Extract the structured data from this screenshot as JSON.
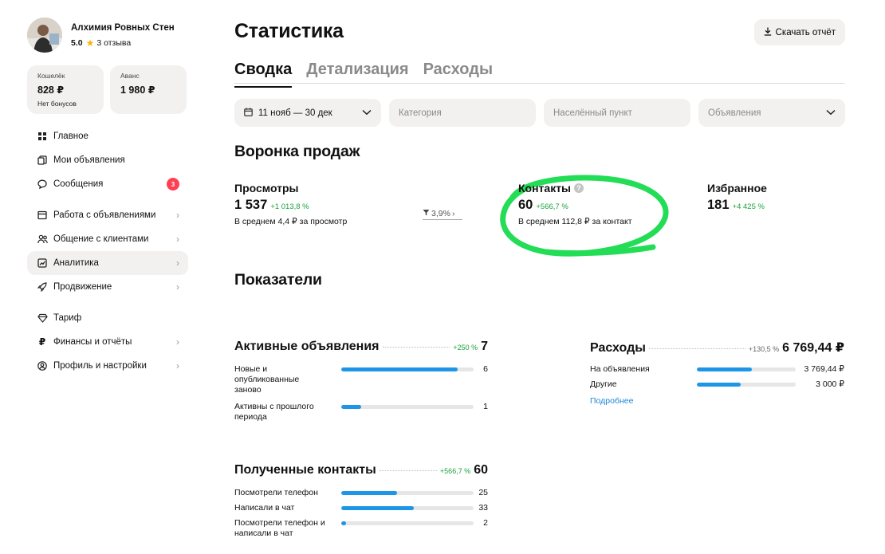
{
  "profile": {
    "name": "Алхимия Ровных Стен",
    "rating": "5.0",
    "reviews": "3 отзыва"
  },
  "balances": {
    "wallet": {
      "label": "Кошелёк",
      "value": "828 ₽",
      "sub": "Нет бонусов"
    },
    "advance": {
      "label": "Аванс",
      "value": "1 980 ₽"
    }
  },
  "nav": {
    "main": "Главное",
    "my_ads": "Мои объявления",
    "messages": "Сообщения",
    "messages_badge": "3",
    "ads_work": "Работа с объявлениями",
    "clients": "Общение с клиентами",
    "analytics": "Аналитика",
    "promotion": "Продвижение",
    "tariff": "Тариф",
    "finance": "Финансы и отчёты",
    "profile": "Профиль и настройки"
  },
  "header": {
    "title": "Статистика",
    "download": "Скачать отчёт"
  },
  "tabs": [
    "Сводка",
    "Детализация",
    "Расходы"
  ],
  "filters": {
    "date": "11 нояб — 30 дек",
    "category": "Категория",
    "city": "Населённый пункт",
    "ads": "Объявления"
  },
  "funnel": {
    "title": "Воронка продаж",
    "views": {
      "label": "Просмотры",
      "value": "1 537",
      "delta": "+1 013,8 %",
      "sub": "В среднем 4,4 ₽ за просмотр"
    },
    "conversion": "3,9%",
    "contacts": {
      "label": "Контакты",
      "value": "60",
      "delta": "+566,7 %",
      "sub": "В среднем 112,8 ₽ за контакт"
    },
    "favorites": {
      "label": "Избранное",
      "value": "181",
      "delta": "+4 425 %"
    }
  },
  "indicators": {
    "title": "Показатели",
    "active_ads": {
      "title": "Активные объявления",
      "delta": "+250 %",
      "total": "7",
      "rows": [
        {
          "label": "Новые и опубликованные заново",
          "value": "6",
          "fraction": 0.88
        },
        {
          "label": "Активны с прошлого периода",
          "value": "1",
          "fraction": 0.15
        }
      ]
    },
    "expenses": {
      "title": "Расходы",
      "delta": "+130,5 %",
      "total": "6 769,44 ₽",
      "rows": [
        {
          "label": "На объявления",
          "value": "3 769,44 ₽",
          "fraction": 0.56
        },
        {
          "label": "Другие",
          "value": "3 000 ₽",
          "fraction": 0.44
        }
      ],
      "more": "Подробнее"
    },
    "contacts": {
      "title": "Полученные контакты",
      "delta": "+566,7 %",
      "total": "60",
      "rows": [
        {
          "label": "Посмотрели телефон",
          "value": "25",
          "fraction": 0.42
        },
        {
          "label": "Написали в чат",
          "value": "33",
          "fraction": 0.55
        },
        {
          "label": "Посмотрели телефон и написали в чат",
          "value": "2",
          "fraction": 0.035
        }
      ]
    }
  },
  "colors": {
    "accent": "#1e96e8",
    "positive": "#1ba33c",
    "badge": "#ff4053",
    "highlight": "#22dd55"
  }
}
